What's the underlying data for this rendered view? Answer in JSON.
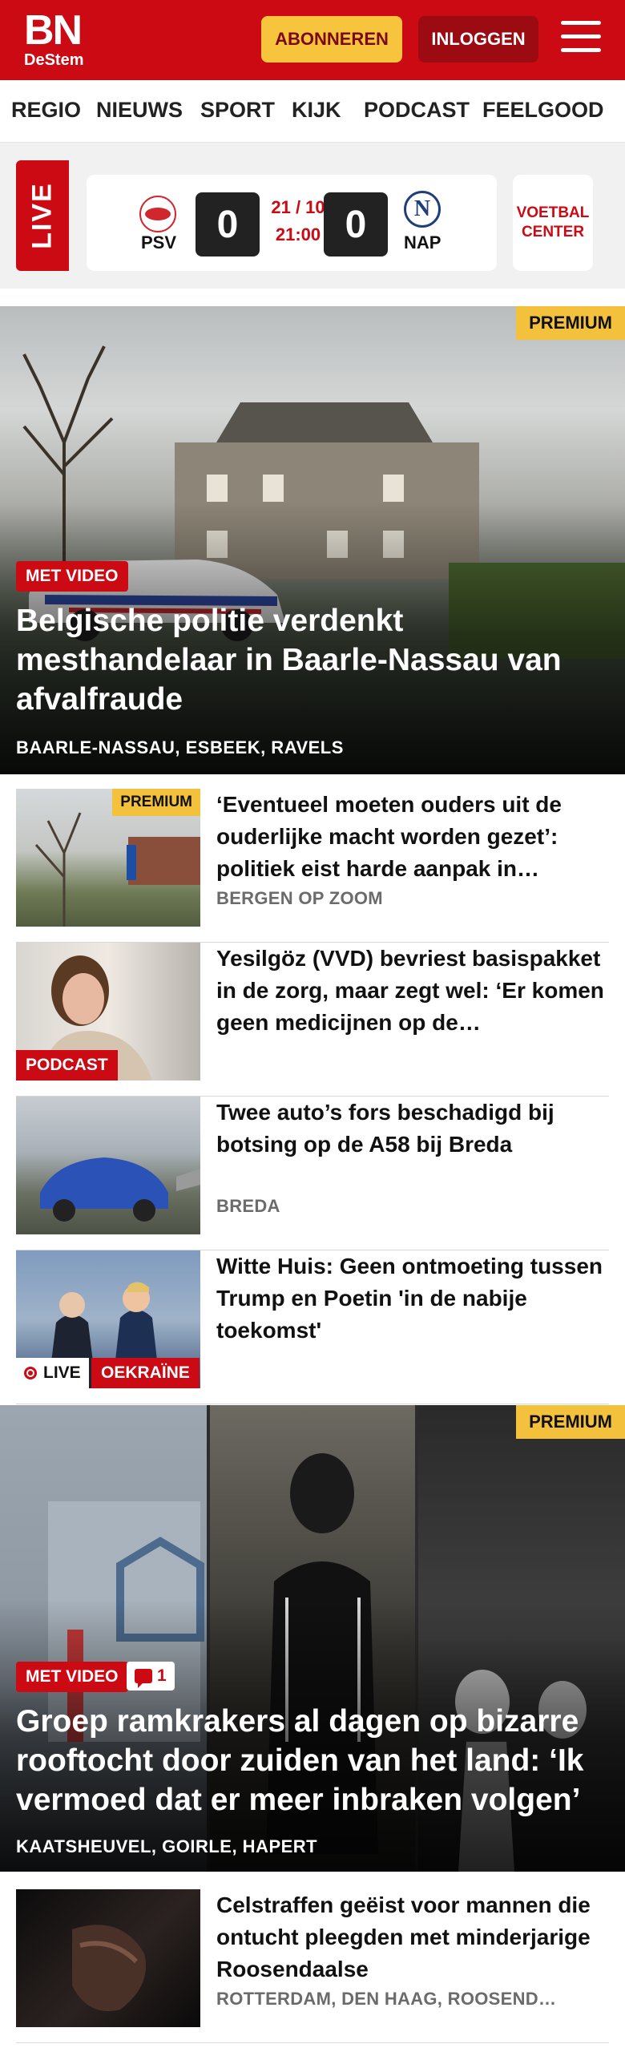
{
  "header": {
    "logo_main": "BN",
    "logo_sub": "DeStem",
    "subscribe_label": "ABONNEREN",
    "login_label": "INLOGGEN"
  },
  "nav": {
    "items": [
      "REGIO",
      "NIEUWS",
      "SPORT",
      "KIJK",
      "PODCAST",
      "FEELGOOD"
    ]
  },
  "live": {
    "label": "LIVE",
    "match": {
      "home": "PSV",
      "away": "NAP",
      "home_score": "0",
      "away_score": "0",
      "date": "21 / 10",
      "time": "21:00"
    },
    "voetbal_center_label": "VOETBAL CENTER"
  },
  "hero1": {
    "premium": "PREMIUM",
    "badge": "MET VIDEO",
    "title": "Belgische politie verdenkt mesthandelaar in Baarle-Nassau van afvalfraude",
    "locations": "BAARLE-NASSAU, ESBEEK, RAVELS"
  },
  "articles": [
    {
      "title": "‘Eventueel moeten ouders uit de ouderlijke macht worden gezet’: politiek eist harde aanpak in…",
      "location": "BERGEN OP ZOOM",
      "premium": "PREMIUM"
    },
    {
      "title": "Yesilgöz (VVD) bevriest basispak­ket in de zorg, maar zegt wel: ‘Er komen geen medicijnen op de…",
      "tag": "PODCAST"
    },
    {
      "title": "Twee auto’s fors beschadigd bij botsing op de A58 bij Breda",
      "location": "BREDA"
    },
    {
      "title": "Witte Huis: Geen ontmoeting tussen Trump en Poetin 'in de nabije toekomst'",
      "live": "LIVE",
      "tag": "OEKRAÏNE"
    }
  ],
  "hero2": {
    "premium": "PREMIUM",
    "badge": "MET VIDEO",
    "comments": "1",
    "title": "Groep ramkrakers al dagen op bizarre rooftocht door zuiden van het land: ‘Ik vermoed dat er meer inbraken volgen’",
    "locations": "KAATSHEUVEL, GOIRLE, HAPERT"
  },
  "articles2": [
    {
      "title": "Celstraffen geëist voor mannen die ontucht pleegden met minderjarige Roosendaalse",
      "location": "ROTTERDAM, DEN HAAG, ROOSEND…"
    }
  ]
}
